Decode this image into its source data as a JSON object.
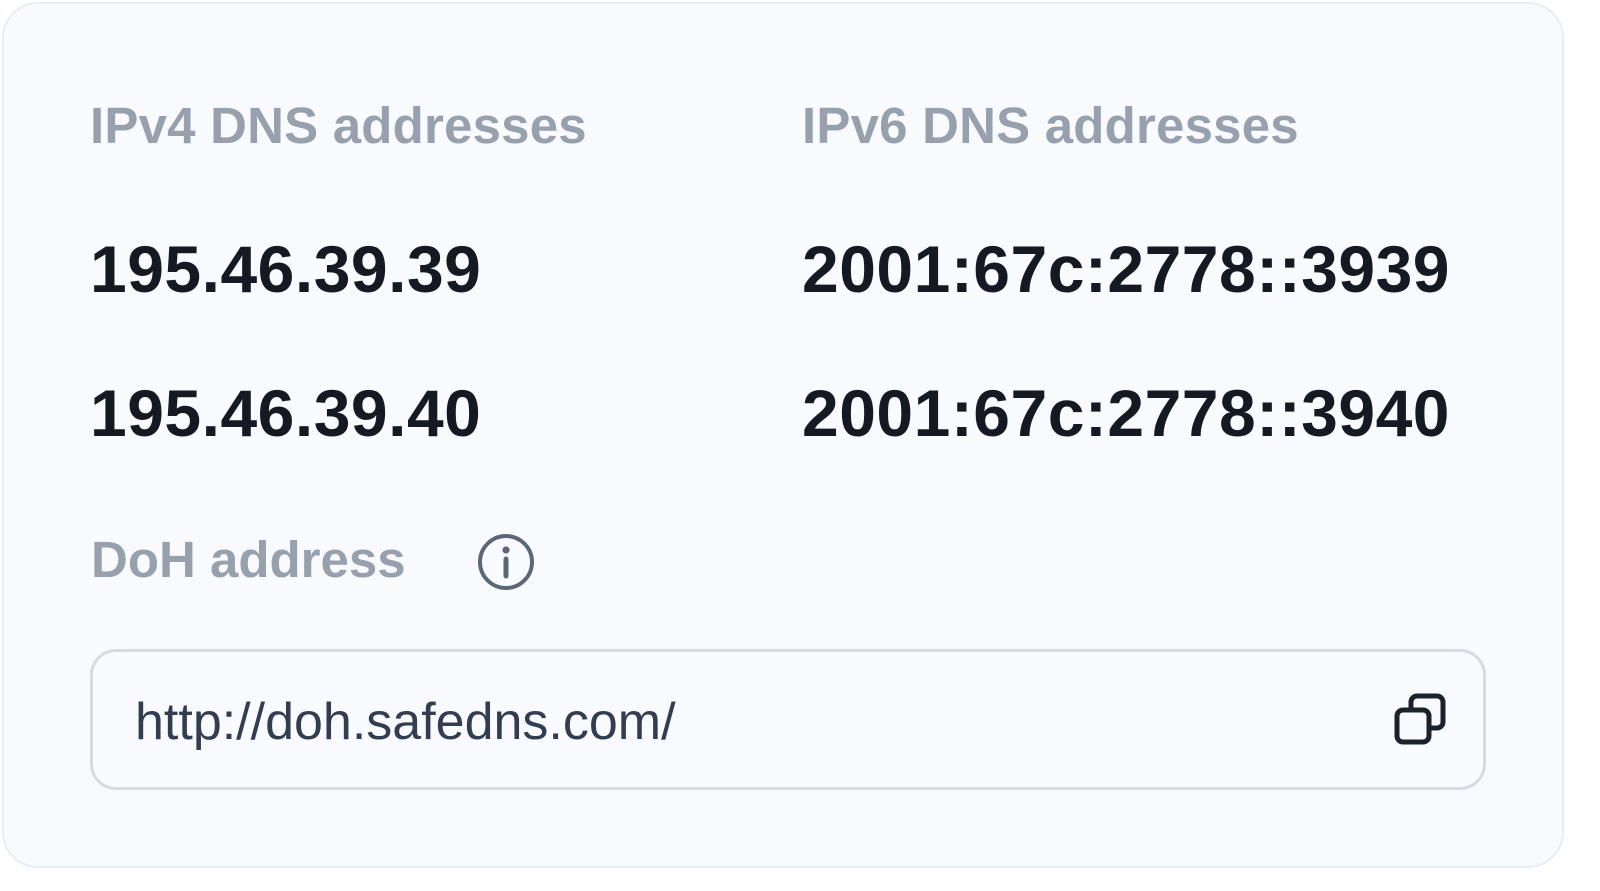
{
  "ipv4": {
    "label": "IPv4 DNS addresses",
    "addresses": [
      "195.46.39.39",
      "195.46.39.40"
    ]
  },
  "ipv6": {
    "label": "IPv6 DNS addresses",
    "addresses": [
      "2001:67c:2778::3939",
      "2001:67c:2778::3940"
    ]
  },
  "doh": {
    "label": "DoH address",
    "value": "http://doh.safedns.com/",
    "info_icon": "info-circle-icon",
    "copy_icon": "copy-icon"
  },
  "colors": {
    "label": "#97a1ae",
    "value": "#151a22",
    "card_bg": "#f8fafe",
    "border": "#d6dbe2"
  }
}
